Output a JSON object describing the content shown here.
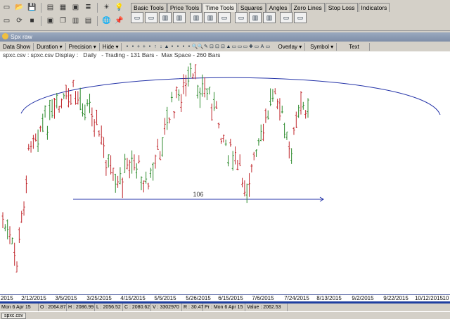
{
  "toolbar": {
    "row1_icons": [
      "new-file-icon",
      "open-folder-icon",
      "save-icon",
      "grid-icon",
      "table-icon",
      "window-icon",
      "list-icon",
      "sun-icon",
      "light-icon"
    ],
    "row1_glyphs": [
      "▭",
      "📂",
      "💾",
      "▤",
      "▦",
      "▣",
      "≣",
      "☀",
      "💡"
    ],
    "row2_icons": [
      "new-chart-icon",
      "refresh-icon",
      "stop-icon",
      "window2-icon",
      "cascade-icon",
      "tile-icon",
      "print-icon",
      "globe-icon",
      "pin-icon"
    ],
    "row2_glyphs": [
      "▭",
      "⟳",
      "■",
      "▣",
      "❐",
      "▥",
      "▤",
      "🌐",
      "📌"
    ]
  },
  "tabs": [
    "Basic Tools",
    "Price Tools",
    "Time Tools",
    "Squares",
    "Angles",
    "Zero Lines",
    "Stop Loss",
    "Indicators"
  ],
  "active_tab": "Time Tools",
  "tool_buttons": [
    "▭",
    "▭",
    "▥",
    "▥",
    "▥",
    "▥",
    "▭",
    "▭",
    "▥",
    "▥",
    "▭",
    "▭"
  ],
  "child_window": {
    "title": "Spx raw"
  },
  "chart_toolbar": {
    "menus": [
      "Data Show",
      "Duration",
      "Precision",
      "Hide"
    ],
    "menus_right": [
      "Overlay",
      "Symbol",
      "Text"
    ],
    "icons": [
      "•",
      "•",
      "+",
      "+",
      "•",
      "↑",
      "↓",
      "▲",
      "•",
      "•",
      "•",
      "•",
      "🔍",
      "🔍",
      "✎",
      "⊡",
      "⊡",
      "⊡",
      "▲",
      "▭",
      "▭",
      "▭",
      "✚",
      "▭",
      "A",
      "▭"
    ]
  },
  "chart_header": "spxc.csv : spxc.csv Display :   Daily   - Trading - 131 Bars -  Max Space - 260 Bars",
  "annotation_label": "106",
  "x_axis": {
    "labels": [
      "2015",
      "2/12/2015",
      "3/5/2015",
      "3/25/2015",
      "4/15/2015",
      "5/5/2015",
      "5/26/2015",
      "6/15/2015",
      "7/6/2015",
      "7/24/2015",
      "8/13/2015",
      "9/2/2015",
      "9/22/2015",
      "10/12/2015",
      "10"
    ]
  },
  "statusbar": {
    "date": "Mon 6 Apr 15",
    "open": "O : 2064.87",
    "high": "H : 2086.99",
    "low": "L : 2056.52",
    "close": "C : 2080.62",
    "volume": "V : 3302970",
    "range": "R : 30.47",
    "pr": "Pr : Mon 6 Apr 15",
    "value": "Value : 2062.53"
  },
  "taskbar": {
    "file": "spxc.csv"
  },
  "colors": {
    "up_bar": "#2e8b2e",
    "down_bar": "#c0282d",
    "arc": "#2433a8",
    "axis_line": "#5060a0"
  }
}
